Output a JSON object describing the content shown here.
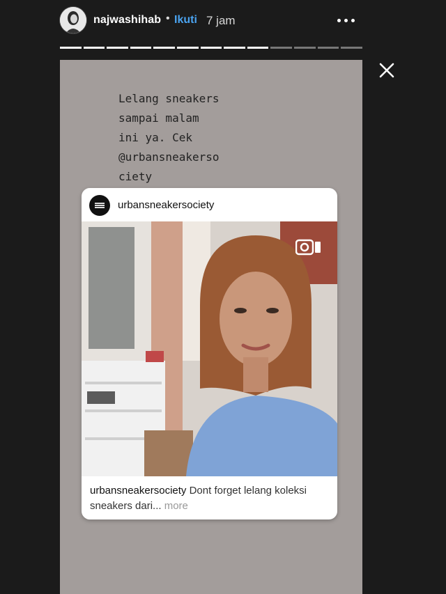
{
  "header": {
    "username": "najwashihab",
    "separator": "•",
    "follow_label": "Ikuti",
    "time": "7 jam",
    "avatar": "user-avatar",
    "more_icon": "more-horizontal-icon"
  },
  "progress": {
    "total_segments": 13,
    "completed_segments": 9
  },
  "close_icon": "close-icon",
  "story": {
    "caption": "Lelang sneakers\nsampai malam\nini ya. Cek\n@urbansneakerso\nciety",
    "shared_post": {
      "username": "urbansneakersociety",
      "media_icon": "video-icon",
      "text_username": "urbansneakersociety",
      "text_body": " Dont forget lelang koleksi sneakers dari",
      "text_ellipsis": "... ",
      "more_label": "more"
    }
  },
  "colors": {
    "follow": "#4aa3f0",
    "story_bg": "#a39d9b",
    "page_bg": "#1b1b1b"
  }
}
